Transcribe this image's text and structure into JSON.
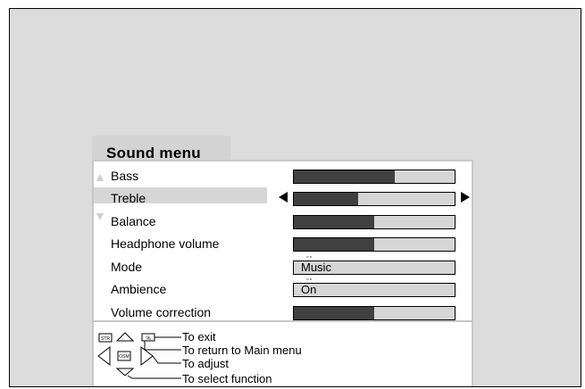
{
  "menu": {
    "title": "Sound menu",
    "items": [
      {
        "label": "Bass",
        "type": "bar",
        "level": 0.63
      },
      {
        "label": "Treble",
        "type": "bar",
        "level": 0.4,
        "selected": true
      },
      {
        "label": "Balance",
        "type": "bar",
        "level": 0.5
      },
      {
        "label": "Headphone volume",
        "type": "bar",
        "level": 0.5
      },
      {
        "label": "Mode",
        "type": "field",
        "value": "Music"
      },
      {
        "label": "Ambience",
        "type": "field",
        "value": "On"
      },
      {
        "label": "Volume correction",
        "type": "bar",
        "level": 0.5
      }
    ]
  },
  "hints": {
    "exit": "To exit",
    "return": "To return to Main menu",
    "adjust": "To adjust",
    "select": "To select function",
    "key_str": "STR",
    "key_pct": "%",
    "key_osm": "OSM"
  },
  "colors": {
    "background": "#dcdcdc",
    "bar_fill": "#404040",
    "bar_empty": "#d6d6d6",
    "highlight": "#d6d6d6"
  }
}
